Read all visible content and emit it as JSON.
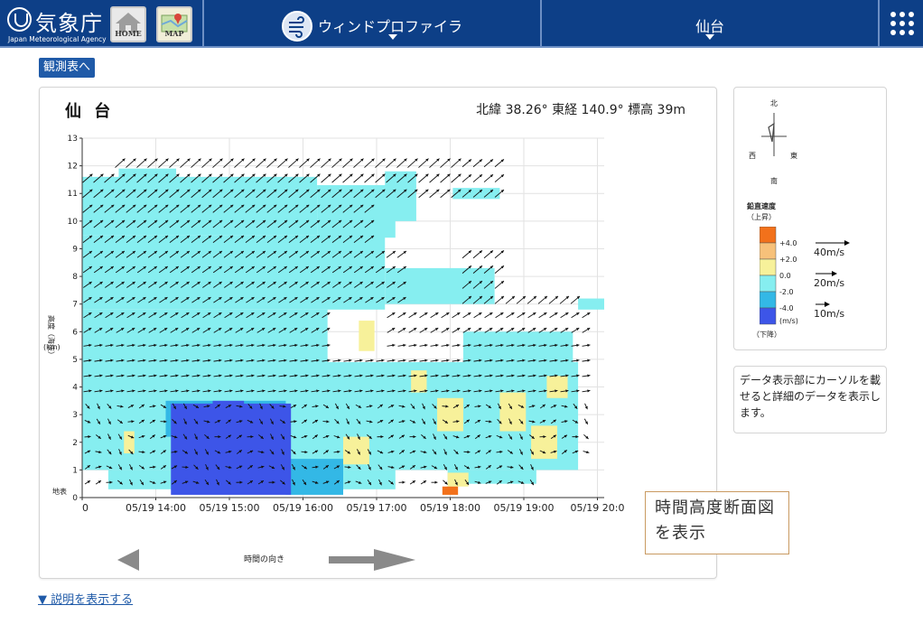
{
  "header": {
    "logo_title": "気象庁",
    "logo_subtitle": "Japan Meteorological Agency",
    "home_label": "HOME",
    "map_label": "MAP",
    "product_label": "ウィンドプロファイラ",
    "station_label": "仙台",
    "icons": [
      "jma-logo-icon",
      "home-icon",
      "map-icon",
      "wind-icon",
      "chevron-down-icon",
      "grid-menu-icon"
    ]
  },
  "obs_button": "観測表へ",
  "panel": {
    "station_title": "仙 台",
    "coords": "北緯 38.26° 東経 140.9° 標高 39m"
  },
  "chart_data": {
    "type": "heatmap",
    "xlabel": "時間の向き",
    "ylabel": "高度（海抜）",
    "yunit": "(km)",
    "ylim": [
      0,
      13
    ],
    "y_ticks": [
      "0",
      "1",
      "2",
      "3",
      "4",
      "5",
      "6",
      "7",
      "8",
      "9",
      "10",
      "11",
      "12",
      "13"
    ],
    "ground_label": "地表",
    "x_ticks": [
      "0",
      "05/19 14:00",
      "05/19 15:00",
      "05/19 16:00",
      "05/19 17:00",
      "05/19 18:00",
      "05/19 19:00",
      "05/19 20:0"
    ],
    "colors": {
      "vz_up_strong": "#f2711b",
      "vz_up_mid": "#f7c17a",
      "vz_up_weak": "#f7f19a",
      "vz_down_weak": "#86eef0",
      "vz_down_mid": "#33b8e6",
      "vz_down_strong": "#3d55e8"
    },
    "wind_arrows": "black arrows from southwest to west-northwest, 10–40 m/s, across 0–12.5 km"
  },
  "legend": {
    "compass": {
      "north": "北",
      "south": "南",
      "west": "西",
      "east": "東"
    },
    "title": "鉛直速度",
    "up_label": "（上昇）",
    "down_label": "（下降）",
    "unit": "(m/s)",
    "ticks": [
      "+4.0",
      "+2.0",
      "0.0",
      "-2.0",
      "-4.0"
    ],
    "speeds": [
      "40m/s",
      "20m/s",
      "10m/s"
    ]
  },
  "info_text": "データ表示部にカーソルを載せると詳細のデータを表示します。",
  "tooltip_text": "時間高度断面図を表示",
  "explain_link": "▼ 説明を表示する"
}
